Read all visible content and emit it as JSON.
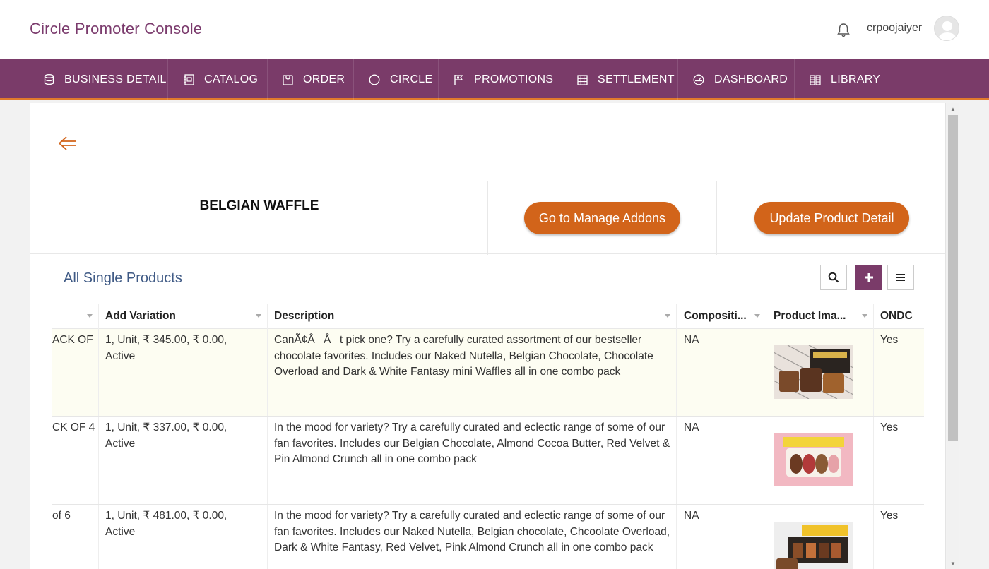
{
  "app": {
    "title": "Circle Promoter Console",
    "username": "crpoojaiyer"
  },
  "nav": {
    "items": [
      {
        "label": "BUSINESS DETAIL",
        "icon": "database-icon"
      },
      {
        "label": "CATALOG",
        "icon": "catalog-icon"
      },
      {
        "label": "ORDER",
        "icon": "order-bag-icon"
      },
      {
        "label": "CIRCLE",
        "icon": "circle-icon"
      },
      {
        "label": "PROMOTIONS",
        "icon": "flag-icon"
      },
      {
        "label": "SETTLEMENT",
        "icon": "grid-table-icon"
      },
      {
        "label": "DASHBOARD",
        "icon": "gauge-icon"
      },
      {
        "label": "LIBRARY",
        "icon": "library-icon"
      }
    ]
  },
  "product": {
    "name": "BELGIAN WAFFLE",
    "manage_addons_label": "Go to Manage Addons",
    "update_detail_label": "Update Product Detail"
  },
  "list": {
    "title": "All Single Products",
    "columns": [
      "",
      "Add Variation",
      "Description",
      "Compositi...",
      "Product Ima...",
      "ONDC"
    ],
    "rows": [
      {
        "name": "ACK OF",
        "variation": "1, Unit, ₹ 345.00, ₹ 0.00, Active",
        "description": "CanÃ¢ÂÂt pick one? Try a carefully curated assortment of our bestseller chocolate favorites. Includes our Naked Nutella, Belgian Chocolate, Chocolate Overload and Dark & White Fantasy mini Waffles all in one combo pack",
        "composition": "NA",
        "ondc": "Yes"
      },
      {
        "name": "CK OF 4",
        "variation": "1, Unit, ₹ 337.00, ₹ 0.00, Active",
        "description": "In the mood for variety? Try a carefully curated and eclectic range of some of our fan favorites. Includes our Belgian Chocolate, Almond Cocoa Butter, Red Velvet & Pin Almond Crunch all in one combo pack",
        "composition": "NA",
        "ondc": "Yes"
      },
      {
        "name": "of 6",
        "variation": "1, Unit, ₹ 481.00, ₹ 0.00, Active",
        "description": "In the mood for variety? Try a carefully curated and eclectic range of some of our fan favorites. Includes our Naked Nutella, Belgian chocolate, Chcoolate Overload, Dark & White Fantasy, Red Velvet, Pink Almond Crunch all in one combo pack",
        "composition": "NA",
        "ondc": "Yes"
      }
    ]
  },
  "colors": {
    "brand": "#7a3b69",
    "accent": "#d2641a",
    "title": "#7b3b6d",
    "link": "#3f5a85"
  }
}
